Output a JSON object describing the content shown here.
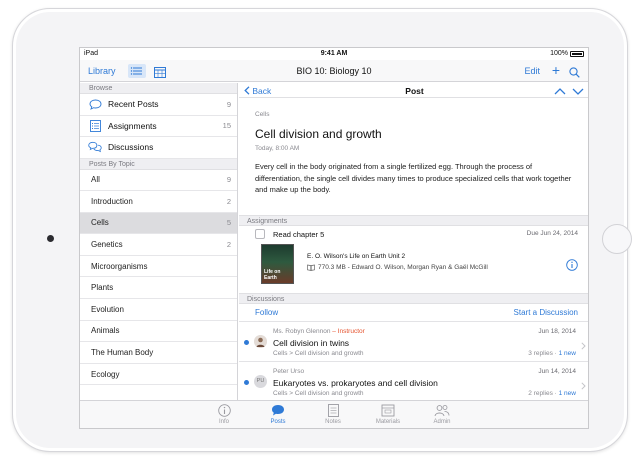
{
  "status": {
    "device": "iPad",
    "time": "9:41 AM",
    "battery": "100%"
  },
  "nav": {
    "library_label": "Library",
    "title": "BIO 10: Biology 10",
    "edit_label": "Edit",
    "plus_icon": "plus-icon",
    "search_icon": "search-icon"
  },
  "sidebar": {
    "browse_header": "Browse",
    "browse_items": [
      {
        "label": "Recent Posts",
        "count": "9",
        "icon": "speech-bubble-icon"
      },
      {
        "label": "Assignments",
        "count": "15",
        "icon": "assignment-icon"
      },
      {
        "label": "Discussions",
        "count": "",
        "icon": "discussions-icon"
      }
    ],
    "topics_header": "Posts By Topic",
    "topics": [
      {
        "label": "All",
        "count": "9"
      },
      {
        "label": "Introduction",
        "count": "2"
      },
      {
        "label": "Cells",
        "count": "5"
      },
      {
        "label": "Genetics",
        "count": "2"
      },
      {
        "label": "Microorganisms",
        "count": ""
      },
      {
        "label": "Plants",
        "count": ""
      },
      {
        "label": "Evolution",
        "count": ""
      },
      {
        "label": "Animals",
        "count": ""
      },
      {
        "label": "The Human Body",
        "count": ""
      },
      {
        "label": "Ecology",
        "count": ""
      }
    ],
    "selected_topic": "Cells"
  },
  "post": {
    "back_label": "Back",
    "header_title": "Post",
    "category": "Cells",
    "title": "Cell division and growth",
    "date": "Today, 8:00 AM",
    "body": "Every cell in the body originated from a single fertilized egg. Through the process of differentiation, the single cell divides many times to produce specialized cells that work together and make up the body."
  },
  "assignments": {
    "header": "Assignments",
    "item": {
      "title": "Read chapter 5",
      "due": "Due Jun 24, 2014",
      "book_title": "E. O. Wilson's Life on Earth Unit 2",
      "book_meta": "770.3 MB - Edward O. Wilson, Morgan Ryan & Gaël McGill",
      "cover_text": "Life on Earth"
    }
  },
  "discussions": {
    "header": "Discussions",
    "follow_label": "Follow",
    "start_label": "Start a Discussion",
    "items": [
      {
        "author": "Ms. Robyn Glennon",
        "role": "– Instructor",
        "title": "Cell division in twins",
        "path": "Cells > Cell division and growth",
        "date": "Jun 18, 2014",
        "replies": "3 replies ·",
        "new": "1 new",
        "avatar": ""
      },
      {
        "author": "Peter Urso",
        "role": "",
        "title": "Eukaryotes vs. prokaryotes and cell division",
        "path": "Cells > Cell division and growth",
        "date": "Jun 14, 2014",
        "replies": "2 replies ·",
        "new": "1 new",
        "avatar": "PU"
      }
    ]
  },
  "tabs": [
    {
      "label": "Info",
      "icon": "info-icon"
    },
    {
      "label": "Posts",
      "icon": "posts-icon"
    },
    {
      "label": "Notes",
      "icon": "notes-icon"
    },
    {
      "label": "Materials",
      "icon": "materials-icon"
    },
    {
      "label": "Admin",
      "icon": "admin-icon"
    }
  ],
  "active_tab": "Posts",
  "colors": {
    "accent": "#2f7ad6",
    "instructor": "#e5532f",
    "selected_row": "#dcdcdf"
  }
}
